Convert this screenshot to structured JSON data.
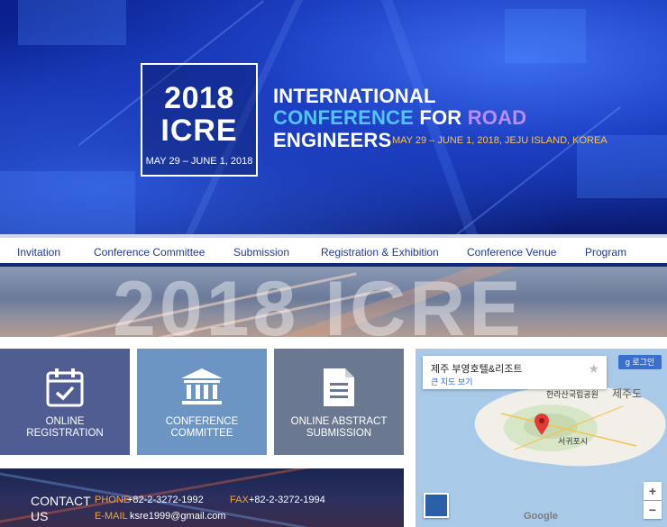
{
  "hero": {
    "logo_year": "2018",
    "logo_name": "ICRE",
    "logo_date": "MAY 29 – JUNE 1, 2018",
    "title_line1": "INTERNATIONAL",
    "title_line2_a": "CONFERENCE",
    "title_line2_b": " FOR ",
    "title_line2_c": "ROAD",
    "title_line3": "ENGINEERS",
    "subtitle": "MAY 29 – JUNE 1, 2018, JEJU ISLAND, KOREA"
  },
  "nav": {
    "items": [
      "Invitation",
      "Conference Committee",
      "Submission",
      "Registration & Exhibition",
      "Conference Venue",
      "Program"
    ]
  },
  "banner": {
    "text": "2018 ICRE"
  },
  "tiles": {
    "registration": "ONLINE\nREGISTRATION",
    "committee": "CONFERENCE\nCOMMITTEE",
    "abstract": "ONLINE ABSTRACT\nSUBMISSION"
  },
  "contact": {
    "title": "CONTACT US",
    "phone_label": "PHONE",
    "phone_value": "+82-2-3272-1992",
    "fax_label": "FAX",
    "fax_value": "+82-2-3272-1994",
    "email_label": "E-MAIL",
    "email_value": "ksre1999@gmail.com"
  },
  "map": {
    "place_name": "제주 부영호텔&리조트",
    "view_larger": "큰 지도 보기",
    "login": "로그인",
    "island_label": "제주도",
    "park_label": "한라산국립공원",
    "city_label": "서귀포시",
    "zoom_in": "+",
    "zoom_out": "−",
    "brand": "Google",
    "star": "★"
  },
  "colors": {
    "nav_text": "#1f3a8c",
    "accent_orange": "#f2a43a",
    "hero_cyan": "#54c2ff",
    "hero_violet": "#b88cff"
  }
}
